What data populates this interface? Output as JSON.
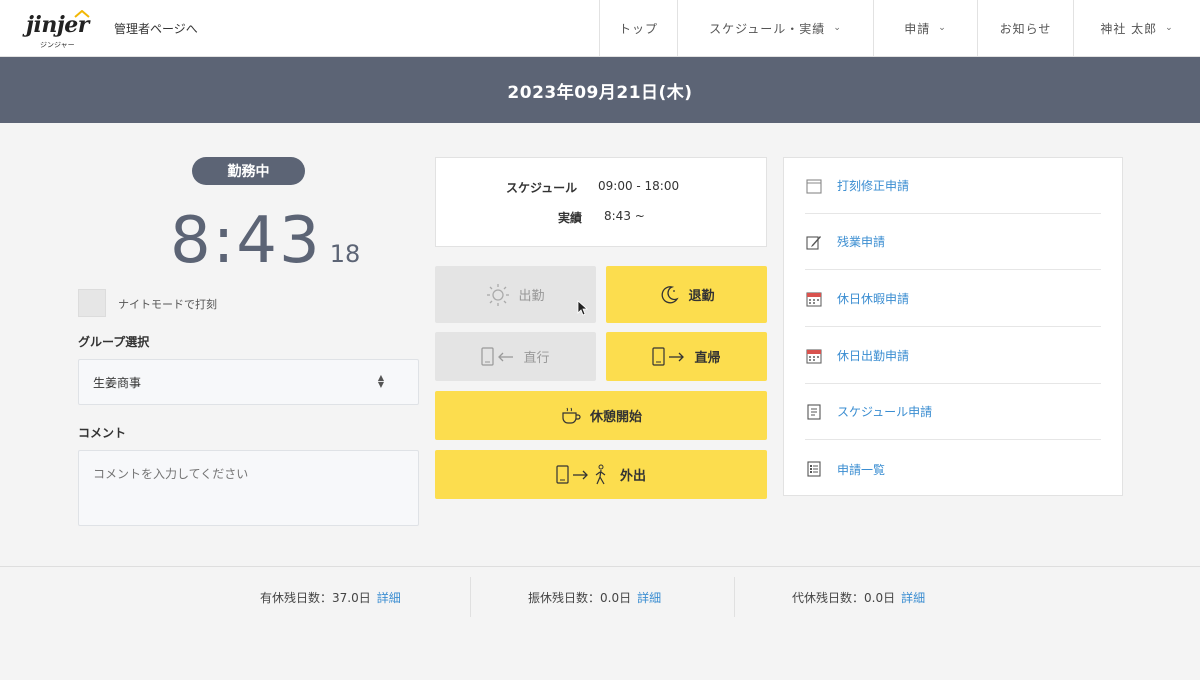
{
  "header": {
    "logo_text": "jinjer",
    "logo_sub": "ジンジャー",
    "admin_link": "管理者ページへ",
    "nav": [
      {
        "label": "トップ",
        "has_menu": false
      },
      {
        "label": "スケジュール・実績",
        "has_menu": true
      },
      {
        "label": "申請",
        "has_menu": true
      },
      {
        "label": "お知らせ",
        "has_menu": false
      },
      {
        "label": "神社 太郎",
        "has_menu": true
      }
    ]
  },
  "date_bar": {
    "date": "2023年09月21日(木)"
  },
  "status": {
    "label": "勤務中"
  },
  "clock": {
    "time": "8:43",
    "seconds": "18"
  },
  "night_mode": {
    "label": "ナイトモードで打刻",
    "checked": false
  },
  "group": {
    "label": "グループ選択",
    "value": "生姜商事"
  },
  "comment": {
    "label": "コメント",
    "placeholder": "コメントを入力してください"
  },
  "schedule": {
    "schedule_label": "スケジュール",
    "schedule_value": "09:00 - 18:00",
    "actual_label": "実績",
    "actual_value": "8:43 ~"
  },
  "punch_buttons": {
    "clock_in": "出勤",
    "clock_out": "退勤",
    "direct_go": "直行",
    "direct_return": "直帰",
    "break_start": "休憩開始",
    "go_out": "外出"
  },
  "requests": [
    {
      "label": "打刻修正申請",
      "icon": "calendar-icon"
    },
    {
      "label": "残業申請",
      "icon": "pen-icon"
    },
    {
      "label": "休日休暇申請",
      "icon": "calendar-red-icon"
    },
    {
      "label": "休日出勤申請",
      "icon": "calendar-red-icon"
    },
    {
      "label": "スケジュール申請",
      "icon": "document-icon"
    },
    {
      "label": "申請一覧",
      "icon": "list-icon"
    }
  ],
  "footer": {
    "paid_leave": {
      "label": "有休残日数：",
      "value": "37.0日",
      "link": "詳細"
    },
    "substitute_leave": {
      "label": "振休残日数：",
      "value": "0.0日",
      "link": "詳細"
    },
    "compensatory_leave": {
      "label": "代休残日数：",
      "value": "0.0日",
      "link": "詳細"
    }
  },
  "colors": {
    "accent_dark": "#5c6475",
    "button_yellow": "#fcdd4e",
    "link_blue": "#3a8dd1"
  }
}
